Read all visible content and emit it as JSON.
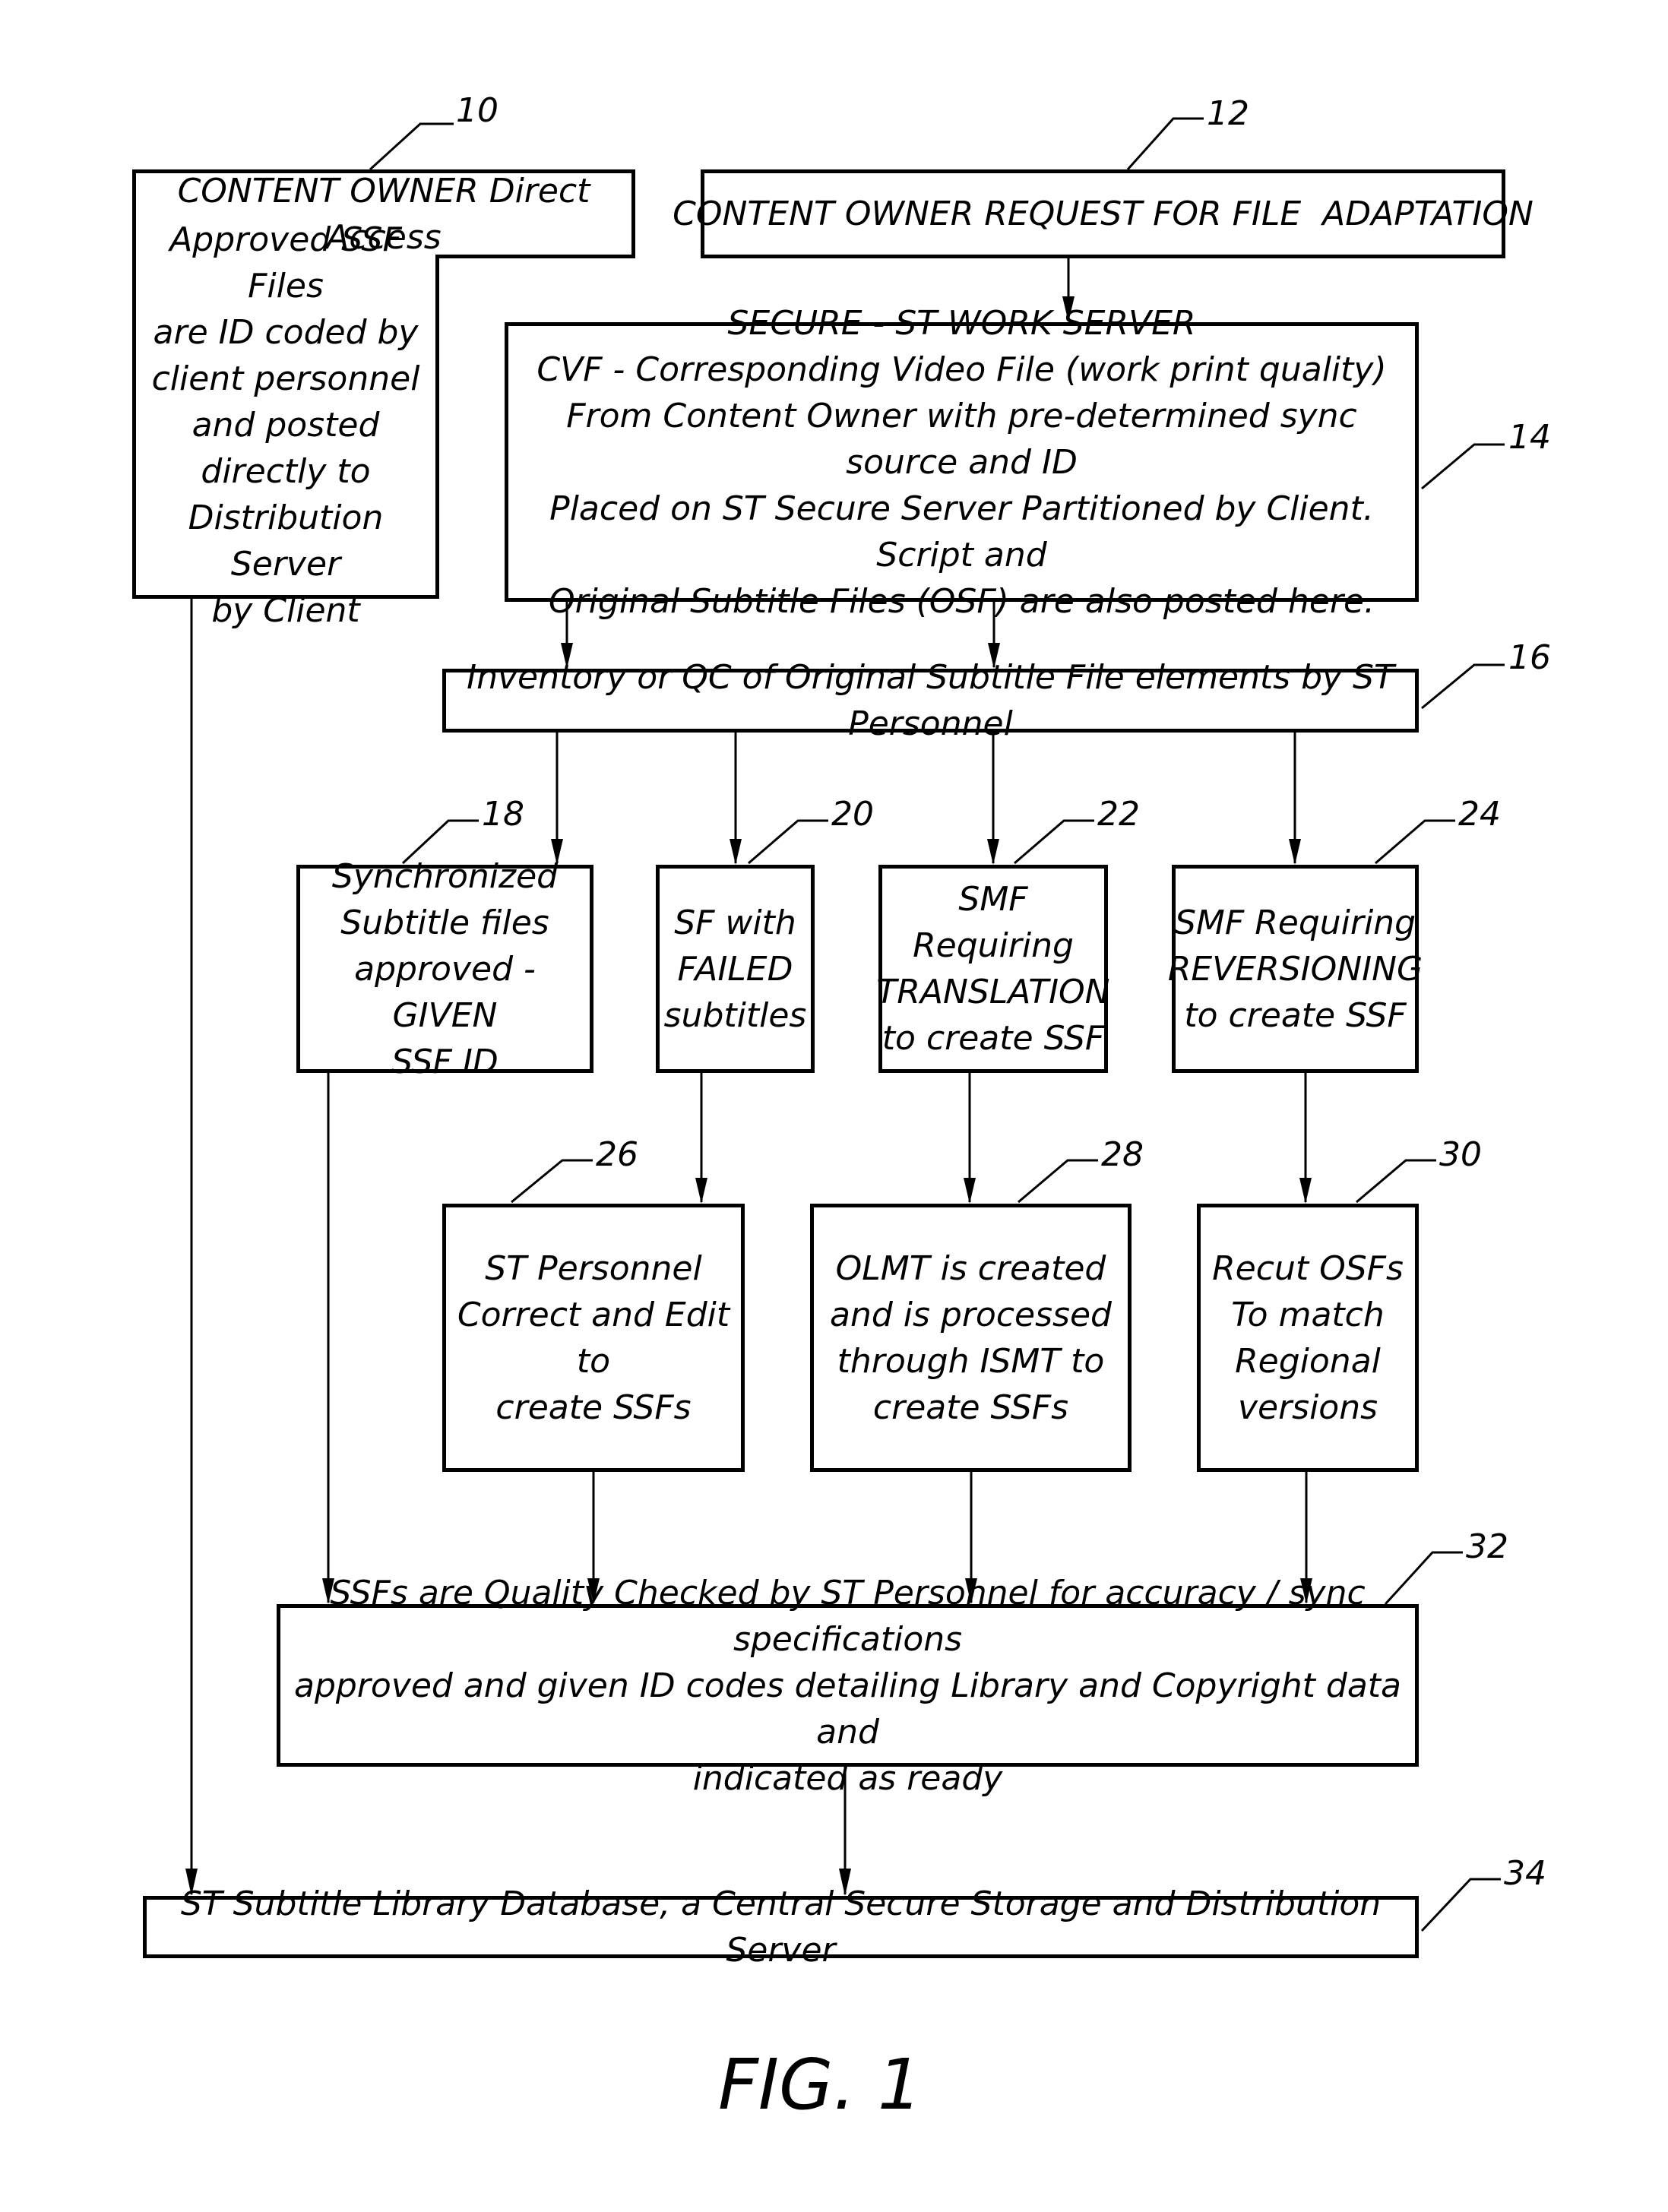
{
  "figure_label": "FIG. 1",
  "nodes": {
    "n10": {
      "ref": "10",
      "title": "CONTENT OWNER Direct Access",
      "text": "Approved SSF Files\nare ID coded by\nclient personnel\nand posted\ndirectly to\nDistribution Server\nby Client"
    },
    "n12": {
      "ref": "12",
      "text": "CONTENT OWNER REQUEST FOR FILE  ADAPTATION"
    },
    "n14": {
      "ref": "14",
      "text": "SECURE - ST WORK SERVER\nCVF - Corresponding Video File (work print quality)\nFrom Content Owner with pre-determined sync source and ID\nPlaced on ST Secure Server Partitioned by Client.  Script and\nOriginal Subtitle Files (OSF) are also posted here."
    },
    "n16": {
      "ref": "16",
      "text": "Inventory or QC of Original Subtitle File elements by ST Personnel"
    },
    "n18": {
      "ref": "18",
      "text": "Synchronized\nSubtitle files\napproved - GIVEN\nSSF ID"
    },
    "n20": {
      "ref": "20",
      "text": "SF with\nFAILED\nsubtitles"
    },
    "n22": {
      "ref": "22",
      "text": "SMF Requiring\nTRANSLATION\nto create SSF"
    },
    "n24": {
      "ref": "24",
      "text": "SMF Requiring\nREVERSIONING\nto create SSF"
    },
    "n26": {
      "ref": "26",
      "text": "ST Personnel\nCorrect and Edit to\ncreate SSFs"
    },
    "n28": {
      "ref": "28",
      "text": "OLMT is created\nand is processed\nthrough ISMT to\ncreate SSFs"
    },
    "n30": {
      "ref": "30",
      "text": "Recut OSFs\nTo match\nRegional\nversions"
    },
    "n32": {
      "ref": "32",
      "text": "SSFs are Quality Checked by ST Personnel for accuracy / sync specifications\napproved and given ID codes detailing Library and Copyright data and\nindicated as ready"
    },
    "n34": {
      "ref": "34",
      "text": "ST Subtitle Library Database, a Central Secure Storage and Distribution Server"
    }
  },
  "edges": [
    [
      "n12",
      "n14"
    ],
    [
      "n14",
      "n16"
    ],
    [
      "n14",
      "n16"
    ],
    [
      "n16",
      "n18"
    ],
    [
      "n16",
      "n20"
    ],
    [
      "n16",
      "n22"
    ],
    [
      "n16",
      "n24"
    ],
    [
      "n20",
      "n26"
    ],
    [
      "n22",
      "n28"
    ],
    [
      "n24",
      "n30"
    ],
    [
      "n18",
      "n32"
    ],
    [
      "n26",
      "n32"
    ],
    [
      "n28",
      "n32"
    ],
    [
      "n30",
      "n32"
    ],
    [
      "n32",
      "n34"
    ],
    [
      "n10",
      "n34"
    ]
  ]
}
